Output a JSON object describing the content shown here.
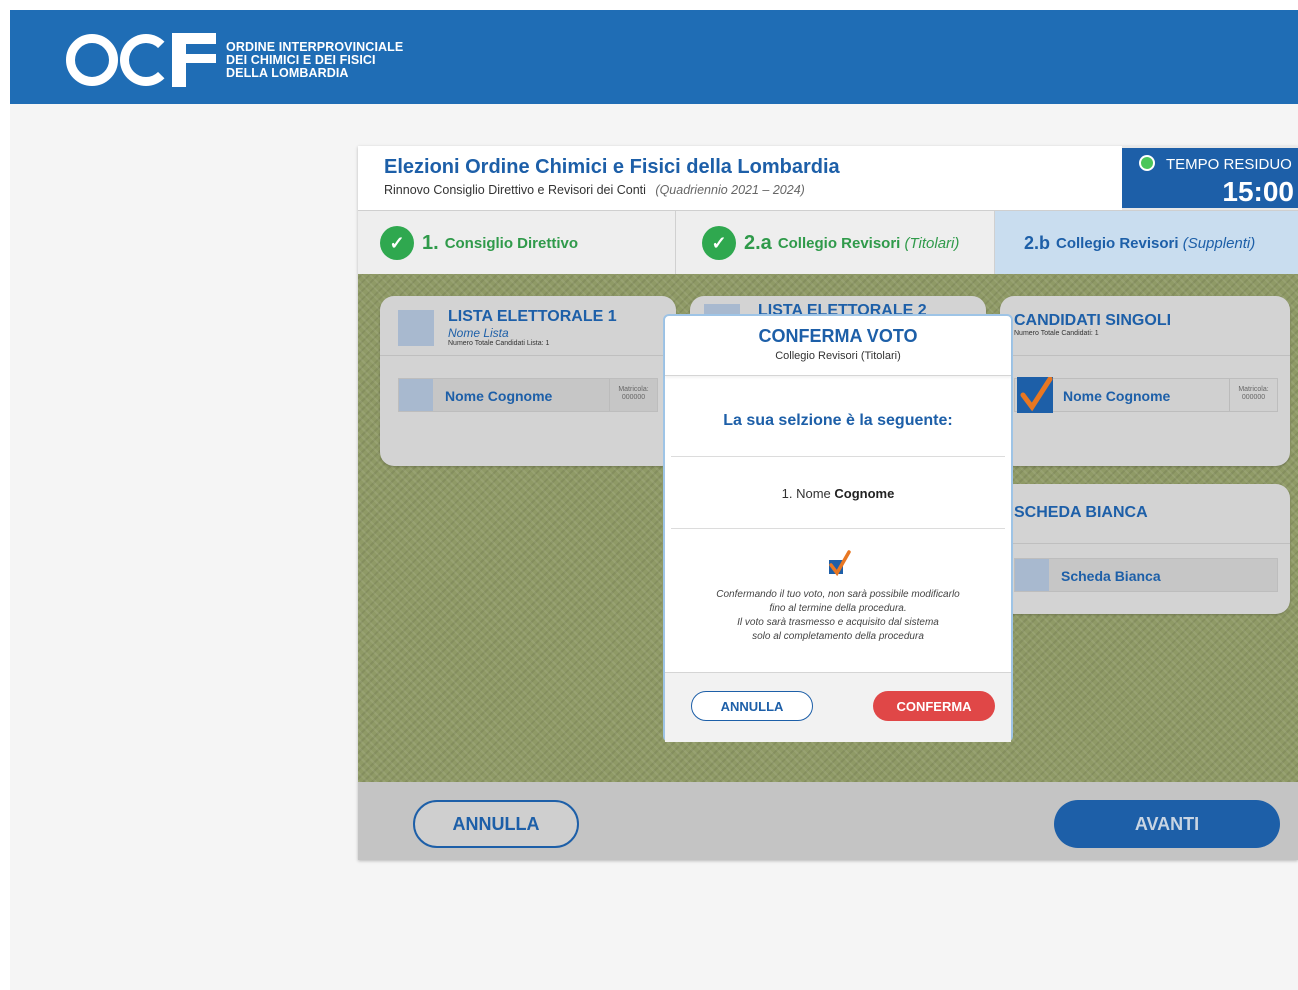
{
  "org": {
    "logo_text": "OCF",
    "name_lines": [
      "ORDINE INTERPROVINCIALE",
      "DEI CHIMICI E DEI FISICI",
      "DELLA LOMBARDIA"
    ]
  },
  "header": {
    "title": "Elezioni Ordine Chimici e Fisici della Lombardia",
    "subtitle": "Rinnovo Consiglio Direttivo e Revisori dei Conti",
    "period": "(Quadriennio 2021 – 2024)"
  },
  "timer": {
    "label": "TEMPO RESIDUO",
    "value": "15:00"
  },
  "steps": [
    {
      "num": "1.",
      "name": "Consiglio Direttivo",
      "qualifier": "",
      "state": "done"
    },
    {
      "num": "2.a",
      "name": "Collegio Revisori",
      "qualifier": "(Titolari)",
      "state": "done"
    },
    {
      "num": "2.b",
      "name": "Collegio Revisori",
      "qualifier": "(Supplenti)",
      "state": "active"
    }
  ],
  "lists": {
    "list1": {
      "title": "LISTA ELETTORALE 1",
      "name": "Nome Lista",
      "count": "Numero Totale Candidati Lista: 1",
      "candidate": "Nome Cognome",
      "matricola": "Matricola: 000000"
    },
    "list2": {
      "title": "LISTA ELETTORALE 2"
    },
    "singoli": {
      "title": "CANDIDATI SINGOLI",
      "count": "Numero Totale Candidati: 1",
      "candidate": "Nome Cognome",
      "matricola": "Matricola: 000000"
    },
    "bianca": {
      "title": "SCHEDA BIANCA",
      "option": "Scheda Bianca"
    }
  },
  "footer": {
    "cancel": "ANNULLA",
    "next": "AVANTI"
  },
  "modal": {
    "title": "CONFERMA VOTO",
    "subtitle": "Collegio Revisori (Titolari)",
    "question": "La sua selzione è la seguente:",
    "selection_prefix": "1. Nome",
    "selection_bold": "Cognome",
    "note_lines": [
      "Confermando il tuo voto, non sarà possibile modificarlo",
      "fino al termine della procedura.",
      "Il voto sarà trasmesso e acquisito dal sistema",
      "solo al completamento della procedura"
    ],
    "cancel": "ANNULLA",
    "confirm": "CONFERMA"
  }
}
